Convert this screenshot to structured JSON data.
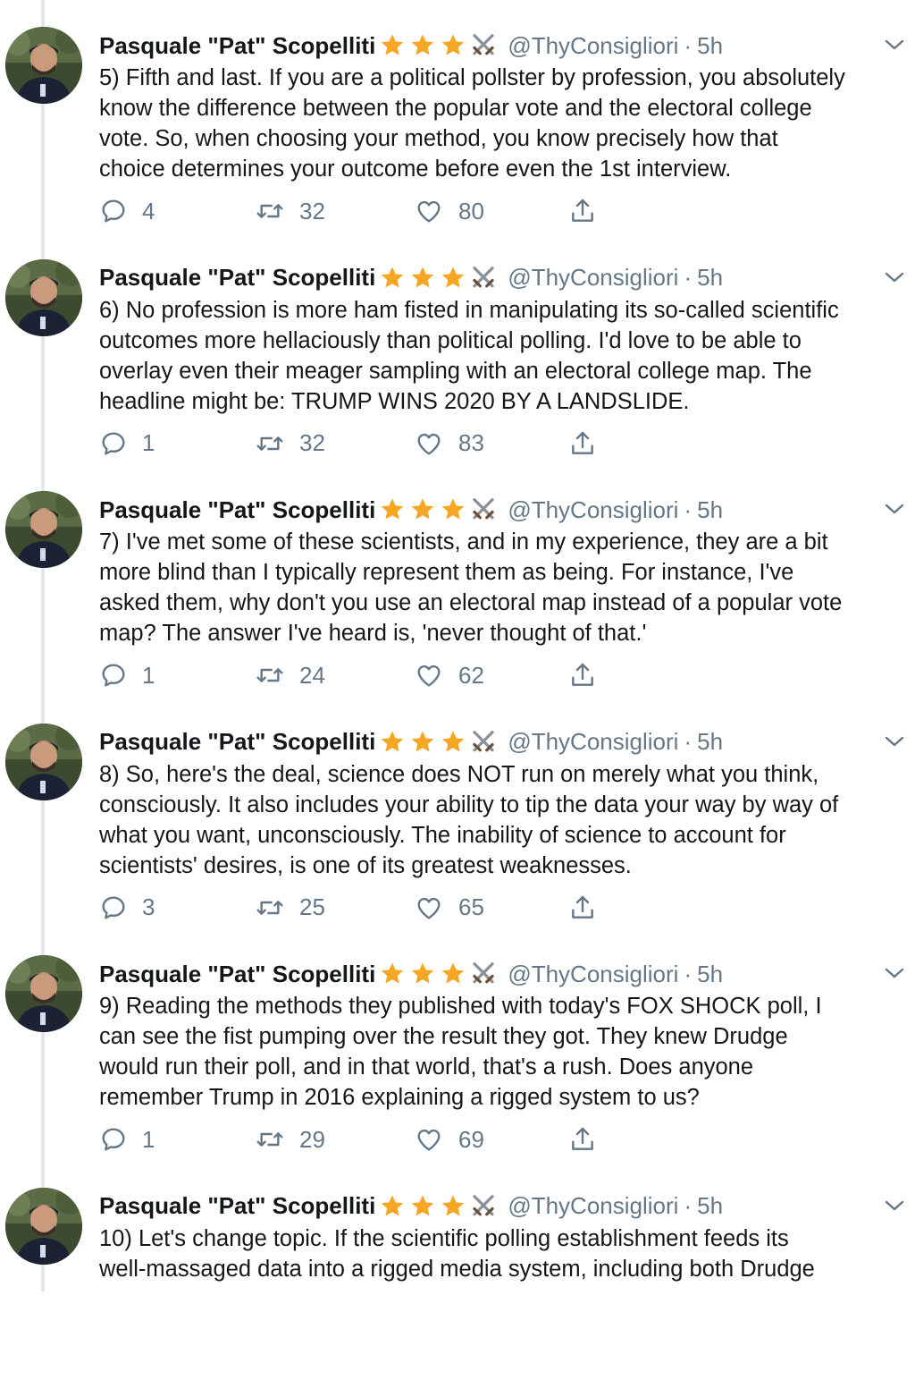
{
  "colors": {
    "accent_star": "#f5a623",
    "muted": "#657786",
    "text": "#14171a",
    "thread_line": "#e1e8ed"
  },
  "tweets": [
    {
      "name": "Pasquale \"Pat\" Scopelliti",
      "handle": "@ThyConsigliori",
      "separator": "·",
      "time": "5h",
      "text": "5) Fifth and last. If you are a political pollster by profession, you absolutely\nknow the difference between the popular vote and the electoral college\nvote. So, when choosing your method, you know precisely how that\nchoice determines your outcome before even the 1st interview.",
      "replies": "4",
      "retweets": "32",
      "likes": "80"
    },
    {
      "name": "Pasquale \"Pat\" Scopelliti",
      "handle": "@ThyConsigliori",
      "separator": "·",
      "time": "5h",
      "text": "6) No profession is more ham fisted in manipulating its so-called scientific\noutcomes more hellaciously than political polling. I'd love to be able to\noverlay even their meager sampling with an electoral college map. The\nheadline might be: TRUMP WINS 2020 BY A LANDSLIDE.",
      "replies": "1",
      "retweets": "32",
      "likes": "83"
    },
    {
      "name": "Pasquale \"Pat\" Scopelliti",
      "handle": "@ThyConsigliori",
      "separator": "·",
      "time": "5h",
      "text": "7) I've met some of these scientists, and in my experience, they are a bit\nmore blind than I typically represent them as being. For instance, I've\nasked them, why don't you use an electoral map instead of a popular vote\nmap? The answer I've heard is, 'never thought of that.'",
      "replies": "1",
      "retweets": "24",
      "likes": "62"
    },
    {
      "name": "Pasquale \"Pat\" Scopelliti",
      "handle": "@ThyConsigliori",
      "separator": "·",
      "time": "5h",
      "text": "8) So, here's the deal, science does NOT run on merely what you think,\nconsciously. It also includes your ability to tip the data your way by way of\nwhat you want, unconsciously. The inability of science to account for\nscientists' desires, is one of its greatest weaknesses.",
      "replies": "3",
      "retweets": "25",
      "likes": "65"
    },
    {
      "name": "Pasquale \"Pat\" Scopelliti",
      "handle": "@ThyConsigliori",
      "separator": "·",
      "time": "5h",
      "text": "9) Reading the methods they published with today's FOX SHOCK poll, I\ncan see the fist pumping over the result they got. They knew Drudge\nwould run their poll, and in that world, that's a rush. Does anyone\nremember Trump in 2016 explaining a rigged system to us?",
      "replies": "1",
      "retweets": "29",
      "likes": "69"
    },
    {
      "name": "Pasquale \"Pat\" Scopelliti",
      "handle": "@ThyConsigliori",
      "separator": "·",
      "time": "5h",
      "text": "10) Let's change topic. If the scientific polling establishment feeds its\nwell-massaged data into a rigged media system, including both Drudge",
      "replies": "",
      "retweets": "",
      "likes": ""
    }
  ]
}
